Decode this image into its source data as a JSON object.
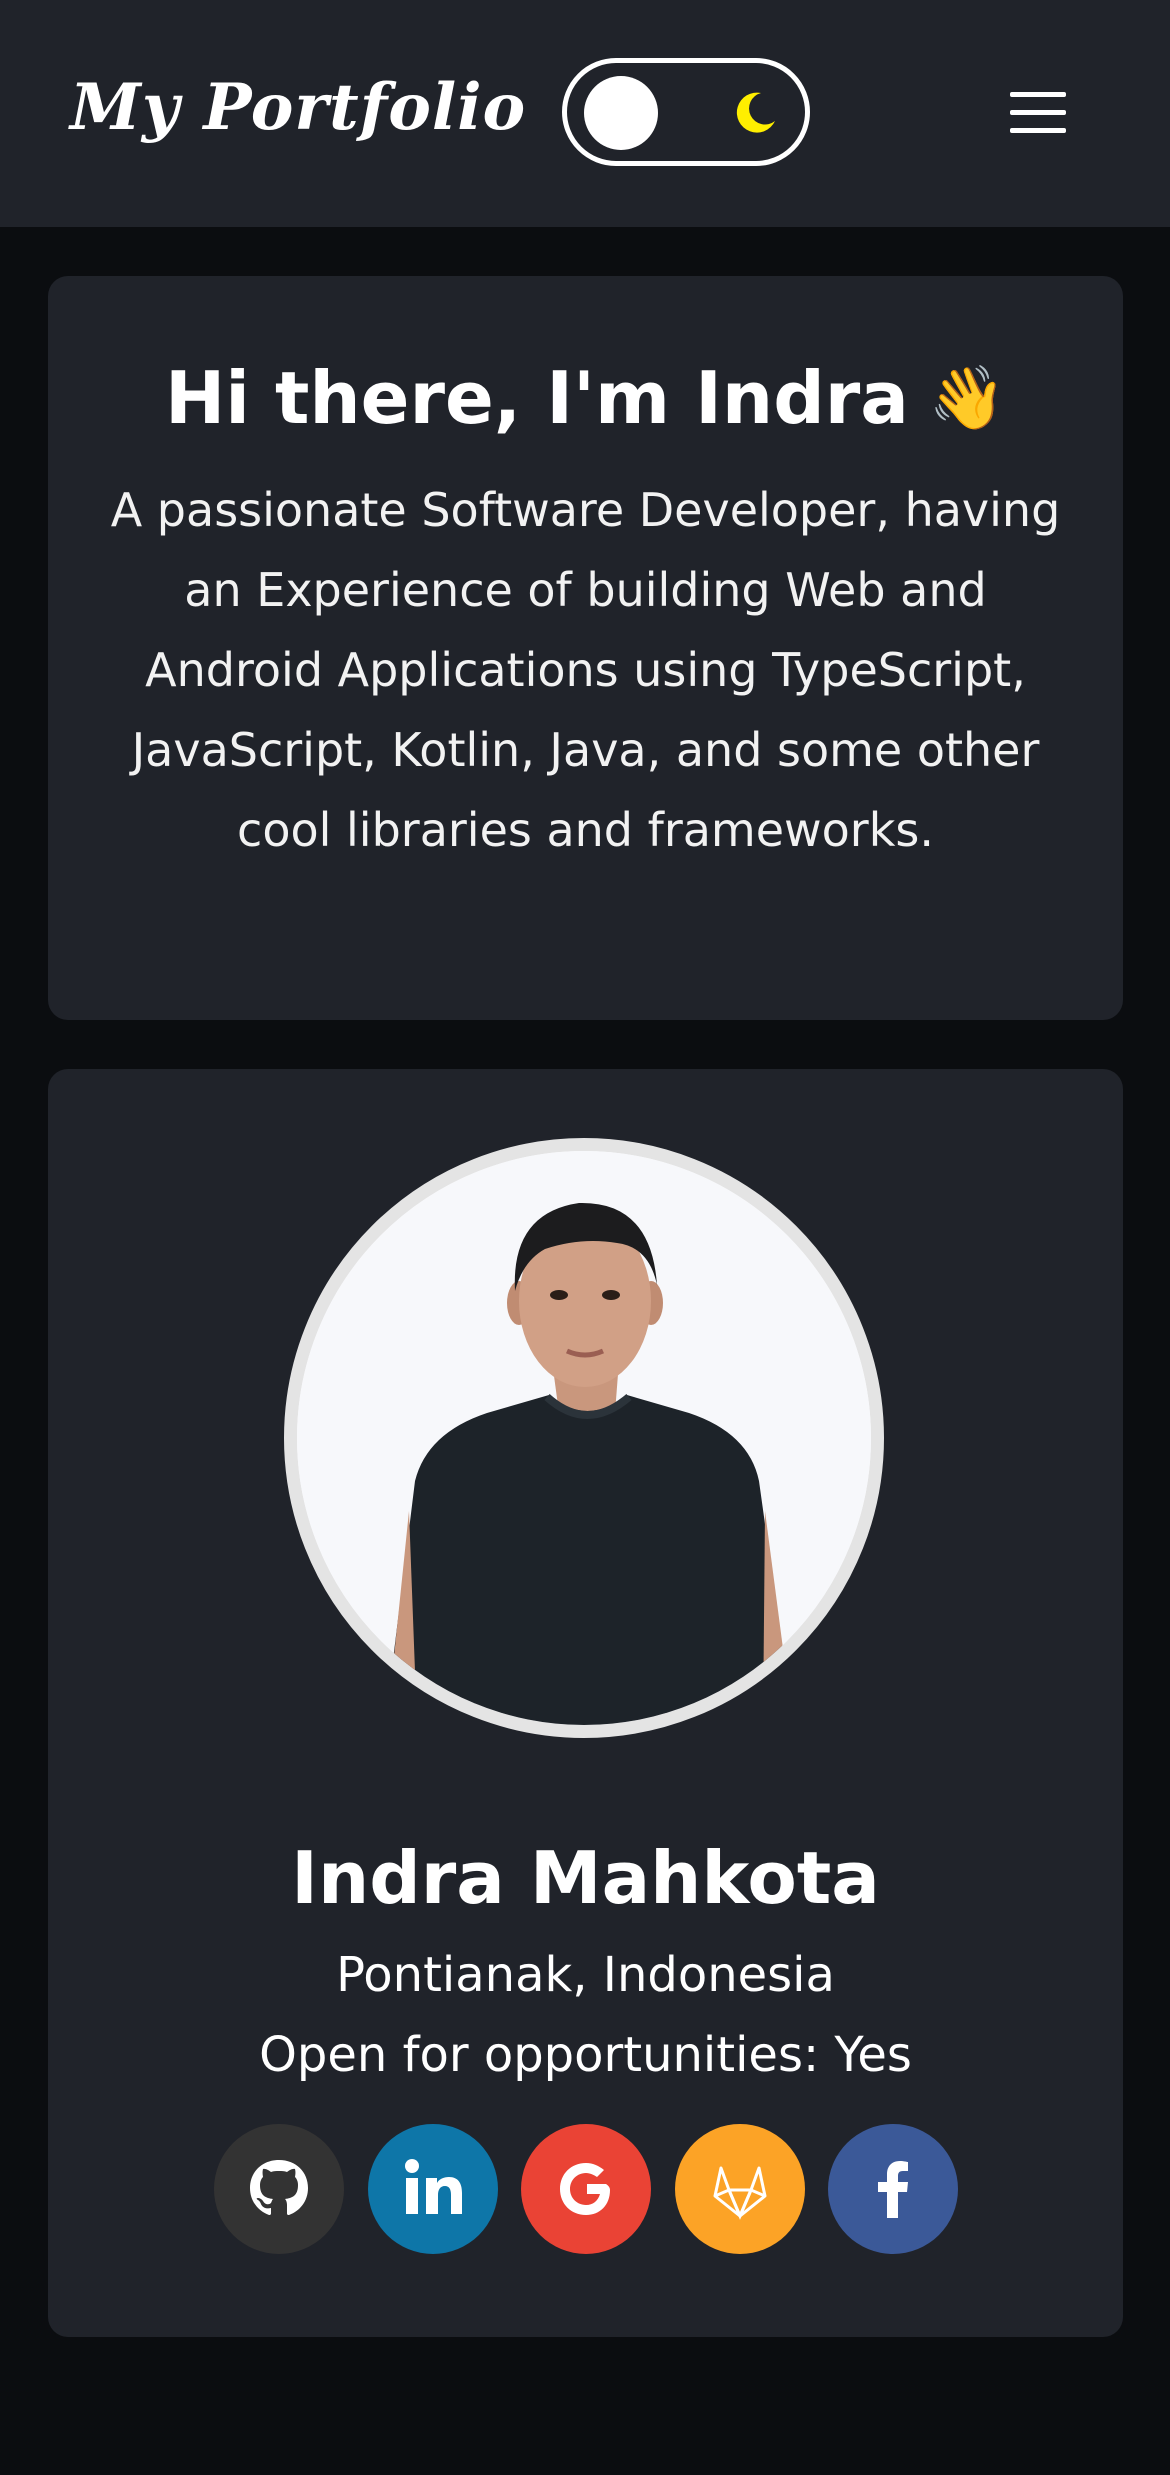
{
  "header": {
    "brand": "My Portfolio",
    "theme_toggle": {
      "mode": "dark",
      "icon": "moon-icon"
    },
    "menu_icon": "hamburger-icon"
  },
  "hero": {
    "title": "Hi there, I'm Indra",
    "emoji": "👋",
    "description": "A passionate Software Developer, having an Experience of building Web and Android Applications using TypeScript, JavaScript, Kotlin, Java, and some other cool libraries and frameworks."
  },
  "profile": {
    "name": "Indra Mahkota",
    "location": "Pontianak, Indonesia",
    "availability": "Open for opportunities: Yes",
    "socials": [
      {
        "name": "github",
        "icon": "github-icon",
        "color": "#333333"
      },
      {
        "name": "linkedin",
        "icon": "linkedin-icon",
        "color": "#0e76a8"
      },
      {
        "name": "google",
        "icon": "google-icon",
        "color": "#ea4335"
      },
      {
        "name": "gitlab",
        "icon": "gitlab-icon",
        "color": "#fca326"
      },
      {
        "name": "facebook",
        "icon": "facebook-icon",
        "color": "#3b5998"
      }
    ]
  },
  "colors": {
    "page_background": "#0b0d10",
    "surface": "#20232a",
    "text": "#ffffff",
    "moon": "#ffef00"
  }
}
